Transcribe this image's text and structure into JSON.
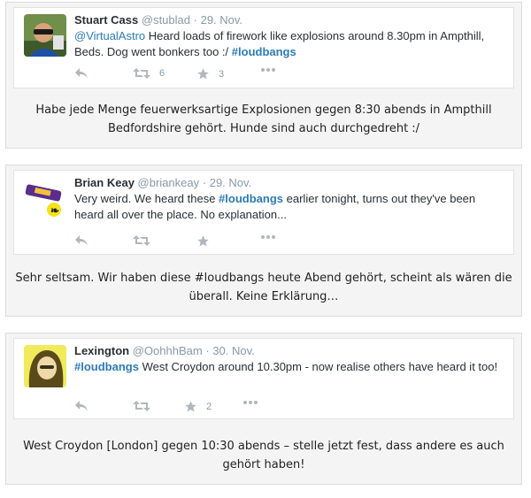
{
  "tweets": [
    {
      "name": "Stuart Cass",
      "handle": "@stublad",
      "sep": "·",
      "date": "29. Nov.",
      "mention": "@VirtualAstro",
      "text_a": " Heard loads of firework like explosions around 8.30pm in Ampthill, Beds. Dog went bonkers too :/ ",
      "hashtag": "#loudbangs",
      "text_b": "",
      "retweets": "6",
      "favorites": "3",
      "translation": "Habe jede Menge feuerwerksartige Explosionen gegen 8:30 abends in Ampthill Bedfordshire gehört. Hunde sind auch durchgedreht :/"
    },
    {
      "name": "Brian Keay",
      "handle": "@briankeay",
      "sep": "·",
      "date": "29. Nov.",
      "mention": "",
      "text_a": "Very weird. We heard these ",
      "hashtag": "#loudbangs",
      "text_b": " earlier tonight,  turns out they've been heard all over the place. No explanation...",
      "retweets": "",
      "favorites": "",
      "translation": "Sehr seltsam. Wir haben diese #loudbangs heute Abend gehört, scheint als wären die überall. Keine Erklärung…"
    },
    {
      "name": "Lexington",
      "handle": "@OohhhBam",
      "sep": "·",
      "date": "30. Nov.",
      "mention": "",
      "text_a": "",
      "hashtag": "#loudbangs",
      "text_b": " West Croydon around 10.30pm - now realise others have heard it too!",
      "retweets": "",
      "favorites": "2",
      "translation": "West Croydon [London] gegen 10:30 abends – stelle jetzt fest, dass andere es auch gehört haben!"
    }
  ],
  "icons": [
    "reply-icon",
    "retweet-icon",
    "favorite-star-icon",
    "more-dots-icon"
  ],
  "colors": {
    "link": "#2b7bb9",
    "action": "#a2a9b0",
    "card_bg": "#f4f4f4"
  }
}
